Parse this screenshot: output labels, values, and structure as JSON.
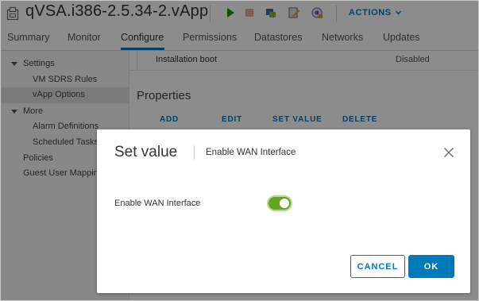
{
  "header": {
    "title": "qVSA.i386-2.5.34-2.vApp",
    "actions_label": "ACTIONS",
    "toolbar_icons": [
      "power-on-icon",
      "power-off-icon",
      "migrate-icon",
      "edit-settings-icon",
      "snapshot-icon"
    ]
  },
  "tabs": [
    {
      "label": "Summary"
    },
    {
      "label": "Monitor"
    },
    {
      "label": "Configure"
    },
    {
      "label": "Permissions"
    },
    {
      "label": "Datastores"
    },
    {
      "label": "Networks"
    },
    {
      "label": "Updates"
    }
  ],
  "active_tab": "Configure",
  "sidebar": {
    "items": [
      {
        "label": "Settings"
      },
      {
        "label": "VM SDRS Rules"
      },
      {
        "label": "vApp Options"
      },
      {
        "label": "More"
      },
      {
        "label": "Alarm Definitions"
      },
      {
        "label": "Scheduled Tasks"
      },
      {
        "label": "Policies"
      },
      {
        "label": "Guest User Mappings"
      }
    ],
    "selected": "vApp Options"
  },
  "main": {
    "boot_row": {
      "label": "Installation boot",
      "value": "Disabled"
    },
    "properties_title": "Properties",
    "actions": {
      "add": "ADD",
      "edit": "EDIT",
      "set_value": "SET VALUE",
      "delete": "DELETE"
    }
  },
  "modal": {
    "title": "Set value",
    "subtitle": "Enable WAN Interface",
    "field_label": "Enable WAN Interface",
    "toggle_on": true,
    "cancel_label": "CANCEL",
    "ok_label": "OK"
  },
  "colors": {
    "accent": "#0079b8",
    "toggle_on": "#62a420"
  }
}
